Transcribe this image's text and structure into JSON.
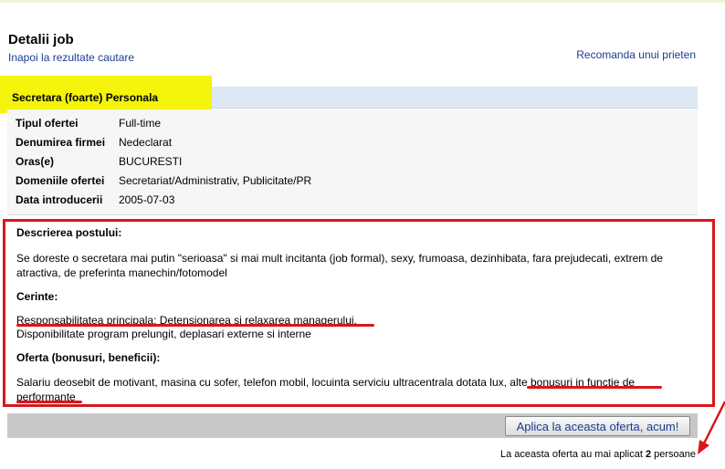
{
  "header": {
    "title": "Detalii job",
    "back_link": "Inapoi la rezultate cautare",
    "recommend_link": "Recomanda unui prieten"
  },
  "job": {
    "title": "Secretara (foarte) Personala",
    "details": [
      {
        "label": "Tipul ofertei",
        "value": "Full-time"
      },
      {
        "label": "Denumirea firmei",
        "value": "Nedeclarat"
      },
      {
        "label": "Oras(e)",
        "value": "BUCURESTI"
      },
      {
        "label": "Domeniile ofertei",
        "value": "Secretariat/Administrativ, Publicitate/PR"
      },
      {
        "label": "Data introducerii",
        "value": "2005-07-03"
      }
    ]
  },
  "description": {
    "heading": "Descrierea postului:",
    "text": "Se doreste o secretara mai putin \"serioasa\" si mai mult incitanta (job formal), sexy, frumoasa, dezinhibata, fara prejudecati, extrem de atractiva, de preferinta manechin/fotomodel"
  },
  "requirements": {
    "heading": "Cerinte:",
    "line1": "Responsabilitatea principala: Detensionarea si relaxarea managerului.",
    "line2": "Disponibilitate program prelungit, deplasari externe si interne"
  },
  "offer": {
    "heading": "Oferta (bonusuri, beneficii):",
    "text_part1": "Salariu deosebit de motivant, masina cu sofer, telefon mobil, locuinta serviciu ultracentrala dotata lux, ",
    "text_part2": "alte bonusuri in functie de performante"
  },
  "actions": {
    "apply_label": "Aplica la aceasta oferta, acum!",
    "count_prefix": "La aceasta oferta au mai aplicat ",
    "count_value": "2",
    "count_suffix": " persoane"
  },
  "colors": {
    "link": "#1a3d8f",
    "highlight": "#f4f40c",
    "annotation_red": "#d8161c",
    "title_bar": "#dde8f4"
  }
}
